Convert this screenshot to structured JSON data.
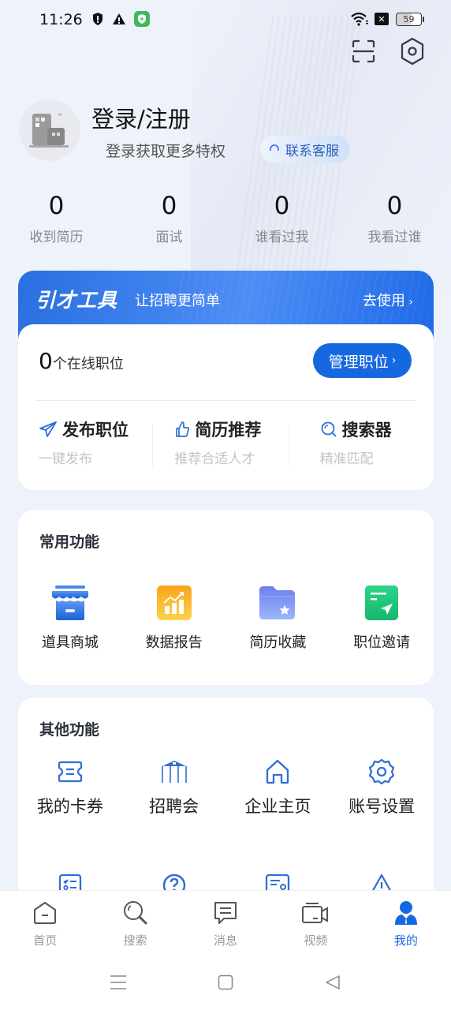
{
  "status_bar": {
    "time": "11:26",
    "battery": "59",
    "icons": [
      "shield-alert-icon",
      "warning-icon",
      "security-app-icon",
      "wifi-icon",
      "sim-blocked-icon",
      "battery-icon"
    ]
  },
  "header": {
    "scan_icon": "scan-icon",
    "settings_icon": "hexagon-settings-icon"
  },
  "profile": {
    "title": "登录/注册",
    "subtitle": "登录获取更多特权",
    "contact_label": "联系客服"
  },
  "stats": [
    {
      "value": "0",
      "label": "收到简历"
    },
    {
      "value": "0",
      "label": "面试"
    },
    {
      "value": "0",
      "label": "谁看过我"
    },
    {
      "value": "0",
      "label": "我看过谁"
    }
  ],
  "tools": {
    "logo": "引才工具",
    "slogan": "让招聘更简单",
    "go_label": "去使用",
    "online_count": "0",
    "online_label": "个在线职位",
    "manage_label": "管理职位",
    "actions": [
      {
        "title": "发布职位",
        "sub": "一键发布",
        "icon": "send-icon"
      },
      {
        "title": "简历推荐",
        "sub": "推荐合适人才",
        "icon": "thumbs-up-icon"
      },
      {
        "title": "搜索器",
        "sub": "精准匹配",
        "icon": "search-icon"
      }
    ]
  },
  "common": {
    "title": "常用功能",
    "items": [
      {
        "label": "道具商城",
        "icon": "shop-icon"
      },
      {
        "label": "数据报告",
        "icon": "chart-report-icon"
      },
      {
        "label": "简历收藏",
        "icon": "folder-star-icon"
      },
      {
        "label": "职位邀请",
        "icon": "invite-send-icon"
      }
    ]
  },
  "other": {
    "title": "其他功能",
    "items": [
      {
        "label": "我的卡券",
        "icon": "coupon-icon"
      },
      {
        "label": "招聘会",
        "icon": "pavilion-icon"
      },
      {
        "label": "企业主页",
        "icon": "home-icon"
      },
      {
        "label": "账号设置",
        "icon": "gear-icon"
      }
    ],
    "items_row2_icons": [
      "checklist-icon",
      "help-icon",
      "resume-card-icon",
      "alert-icon"
    ]
  },
  "bottom_nav": [
    {
      "label": "首页",
      "icon": "home-tab-icon",
      "active": false
    },
    {
      "label": "搜索",
      "icon": "search-tab-icon",
      "active": false
    },
    {
      "label": "消息",
      "icon": "message-tab-icon",
      "active": false
    },
    {
      "label": "视频",
      "icon": "video-tab-icon",
      "active": false
    },
    {
      "label": "我的",
      "icon": "profile-tab-icon",
      "active": true
    }
  ],
  "colors": {
    "accent": "#1668e0",
    "background": "#eef2fb",
    "banner": "#2a6fe0"
  }
}
